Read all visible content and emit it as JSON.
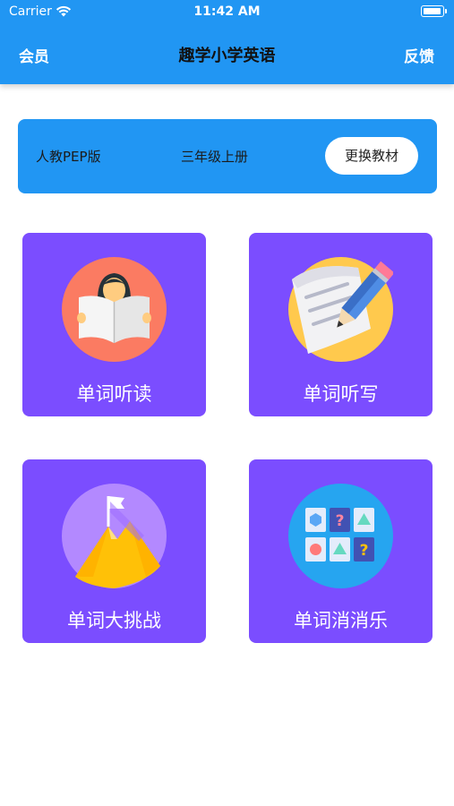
{
  "status_bar": {
    "carrier": "Carrier",
    "time": "11:42 AM"
  },
  "nav": {
    "left": "会员",
    "title": "趣学小学英语",
    "right": "反馈"
  },
  "book": {
    "edition": "人教PEP版",
    "grade": "三年级上册",
    "change_button": "更换教材"
  },
  "cards": [
    {
      "label": "单词听读",
      "icon": "reading-person-icon"
    },
    {
      "label": "单词听写",
      "icon": "pencil-paper-icon"
    },
    {
      "label": "单词大挑战",
      "icon": "mountain-flag-icon"
    },
    {
      "label": "单词消消乐",
      "icon": "match-grid-icon"
    }
  ],
  "colors": {
    "primary": "#2196f3",
    "card": "#7b4dff"
  }
}
